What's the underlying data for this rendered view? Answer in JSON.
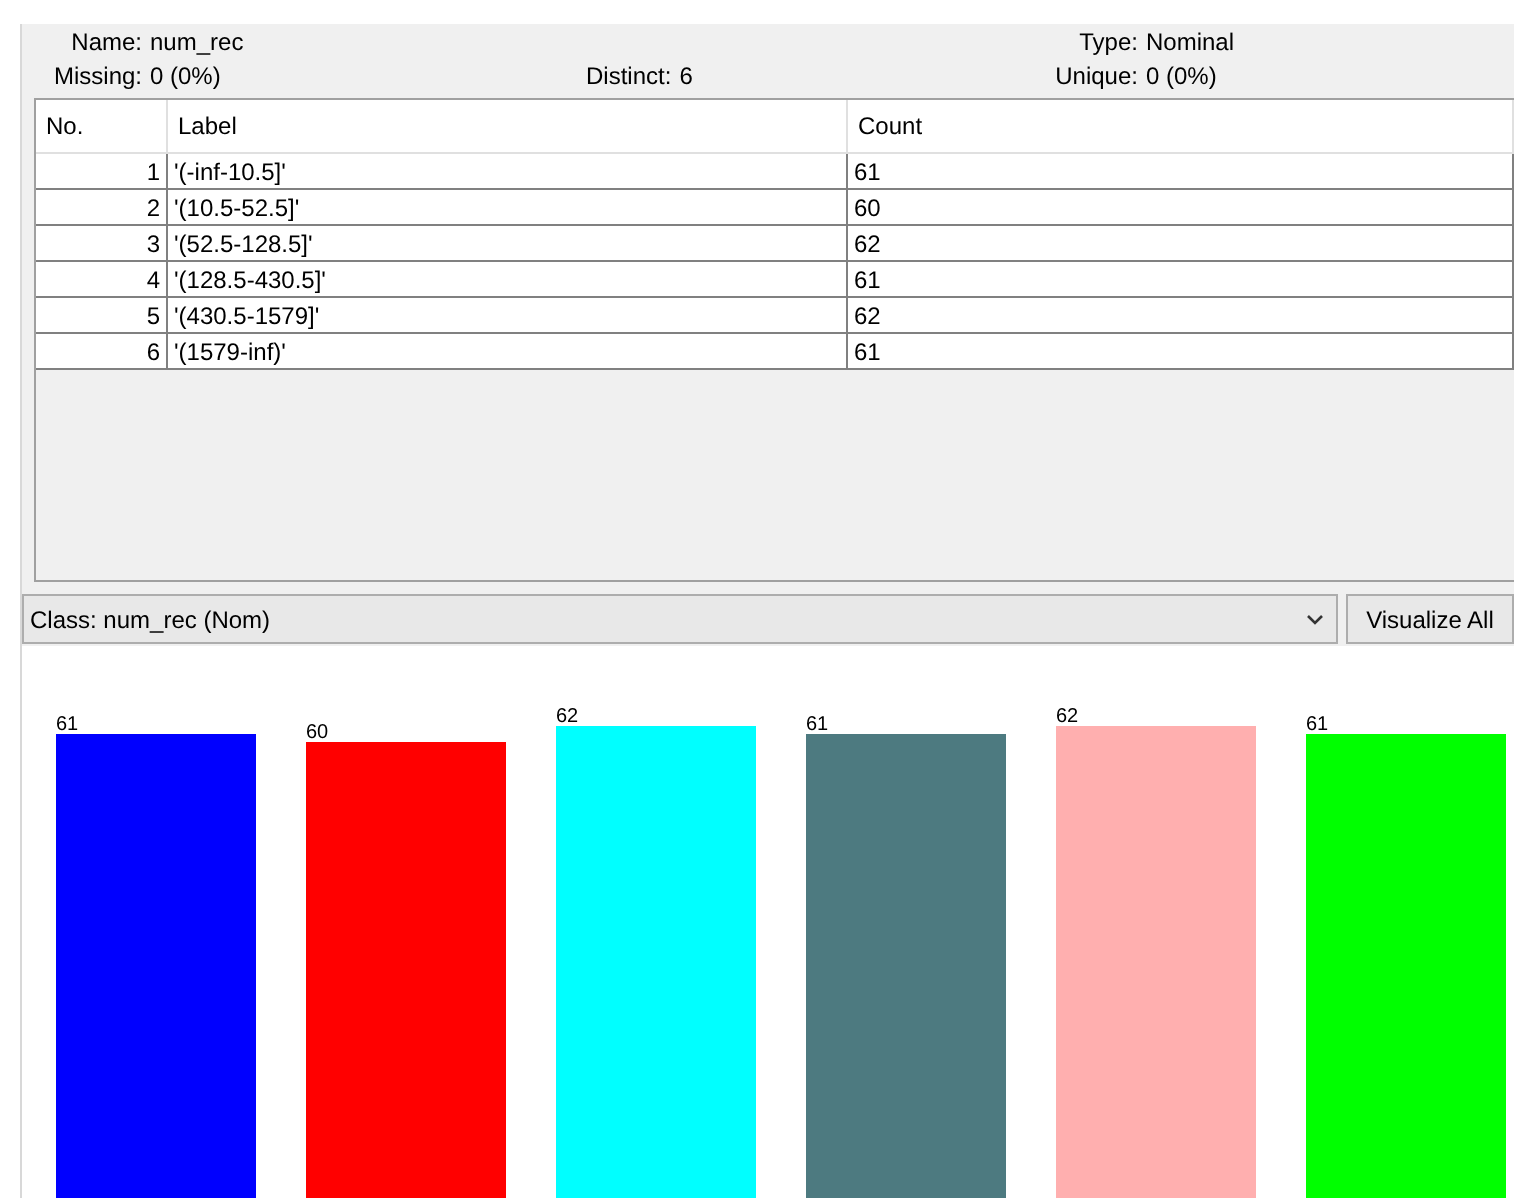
{
  "attribute": {
    "name": {
      "label": "Name:",
      "value": "num_rec"
    },
    "missing": {
      "label": "Missing:",
      "value": "0 (0%)"
    },
    "distinct": {
      "label": "Distinct:",
      "value": "6"
    },
    "type": {
      "label": "Type:",
      "value": "Nominal"
    },
    "unique": {
      "label": "Unique:",
      "value": "0 (0%)"
    }
  },
  "table": {
    "columns": [
      "No.",
      "Label",
      "Count"
    ],
    "rows": [
      {
        "no": "1",
        "label": "'(-inf-10.5]'",
        "count": "61"
      },
      {
        "no": "2",
        "label": "'(10.5-52.5]'",
        "count": "60"
      },
      {
        "no": "3",
        "label": "'(52.5-128.5]'",
        "count": "62"
      },
      {
        "no": "4",
        "label": "'(128.5-430.5]'",
        "count": "61"
      },
      {
        "no": "5",
        "label": "'(430.5-1579]'",
        "count": "62"
      },
      {
        "no": "6",
        "label": "'(1579-inf)'",
        "count": "61"
      }
    ]
  },
  "class_select": {
    "value": "Class: num_rec (Nom)"
  },
  "visualize_button": "Visualize All",
  "chart_data": {
    "type": "bar",
    "data_labels": true,
    "series": [
      {
        "color": "#0000ff",
        "values": [
          61
        ]
      },
      {
        "color": "#ff0000",
        "values": [
          60
        ]
      },
      {
        "color": "#00ffff",
        "values": [
          62
        ]
      },
      {
        "color": "#4d7a80",
        "values": [
          61
        ]
      },
      {
        "color": "#ffafaf",
        "values": [
          62
        ]
      },
      {
        "color": "#00ff00",
        "values": [
          61
        ]
      }
    ]
  }
}
